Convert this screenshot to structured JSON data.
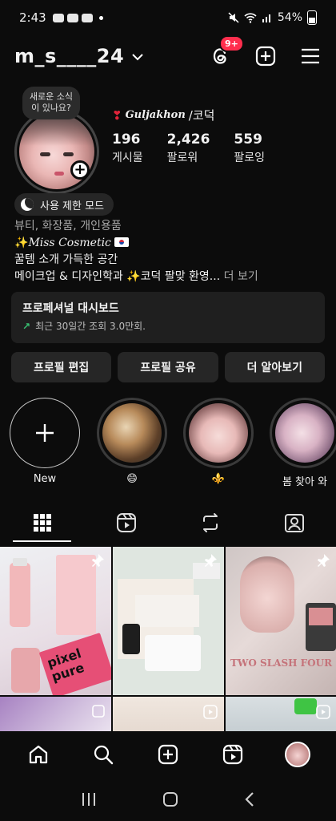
{
  "status": {
    "time": "2:43",
    "battery": "54%"
  },
  "header": {
    "username": "m_s____24",
    "threads_badge": "9+"
  },
  "profile": {
    "note": "새로운 소식이 있나요?",
    "display_name": "Guljakhon",
    "display_name_suffix": "/코덕",
    "stats": [
      {
        "num": "196",
        "label": "게시물"
      },
      {
        "num": "2,426",
        "label": "팔로워"
      },
      {
        "num": "559",
        "label": "팔로잉"
      }
    ],
    "mode_label": "사용 제한 모드",
    "bio": {
      "category": "뷰티, 화장품, 개인용품",
      "line1": "Miss Cosmetic",
      "line2": " 꿀템 소개 가득한 공간",
      "line3": "메이크업 & 디자인학과 ✨코덕 팔맞 환영...",
      "more": "더 보기"
    },
    "dashboard": {
      "title": "프로페셔널 대시보드",
      "subtitle": "최근 30일간 조회 3.0만회."
    },
    "buttons": {
      "edit": "프로필 편집",
      "share": "프로필 공유",
      "more": "더 알아보기"
    }
  },
  "highlights": [
    {
      "label": "New"
    },
    {
      "label": "😄"
    },
    {
      "label": "⚜️"
    },
    {
      "label": "봄 찾아 와"
    }
  ],
  "grid": {
    "post1_text": "pixel pure",
    "post3_text": "TWO SLASH FOUR"
  },
  "icons": {
    "threads": "threads-icon",
    "create": "plus-square-icon",
    "menu": "hamburger-icon",
    "home": "home-icon",
    "search": "search-icon",
    "reels": "reels-icon"
  },
  "colors": {
    "background": "#0c0c0c",
    "badge": "#ff2e4d",
    "surface": "#262626",
    "trend": "#38c172"
  }
}
